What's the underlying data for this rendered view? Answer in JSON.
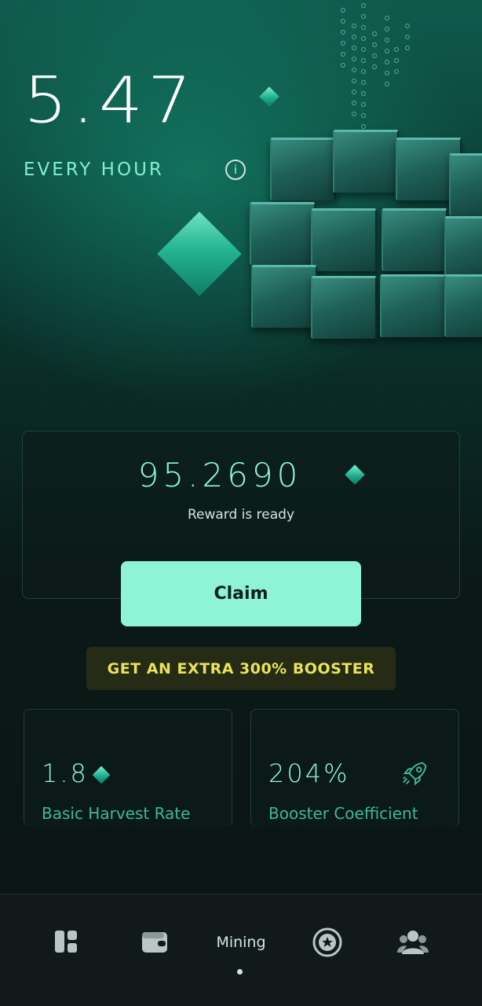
{
  "mining": {
    "rate_value": "5.47",
    "rate_unit": "EVERY HOUR",
    "reward_amount": "95.2690",
    "reward_status": "Reward is ready",
    "claim_label": "Claim",
    "booster_banner": "GET AN EXTRA 300% BOOSTER"
  },
  "stats": [
    {
      "value": "1.8",
      "label": "Basic Harvest Rate",
      "icon": "diamond-icon"
    },
    {
      "value": "204%",
      "label": "Booster Coefficient",
      "icon": "rocket-icon"
    }
  ],
  "nav": {
    "items": [
      {
        "icon": "dashboard-icon"
      },
      {
        "icon": "wallet-icon"
      },
      {
        "label": "Mining"
      },
      {
        "icon": "star-badge-icon"
      },
      {
        "icon": "team-icon"
      }
    ]
  },
  "colors": {
    "accent": "#8ff3d6",
    "booster_text": "#e8e35a",
    "background": "#0a1917"
  }
}
